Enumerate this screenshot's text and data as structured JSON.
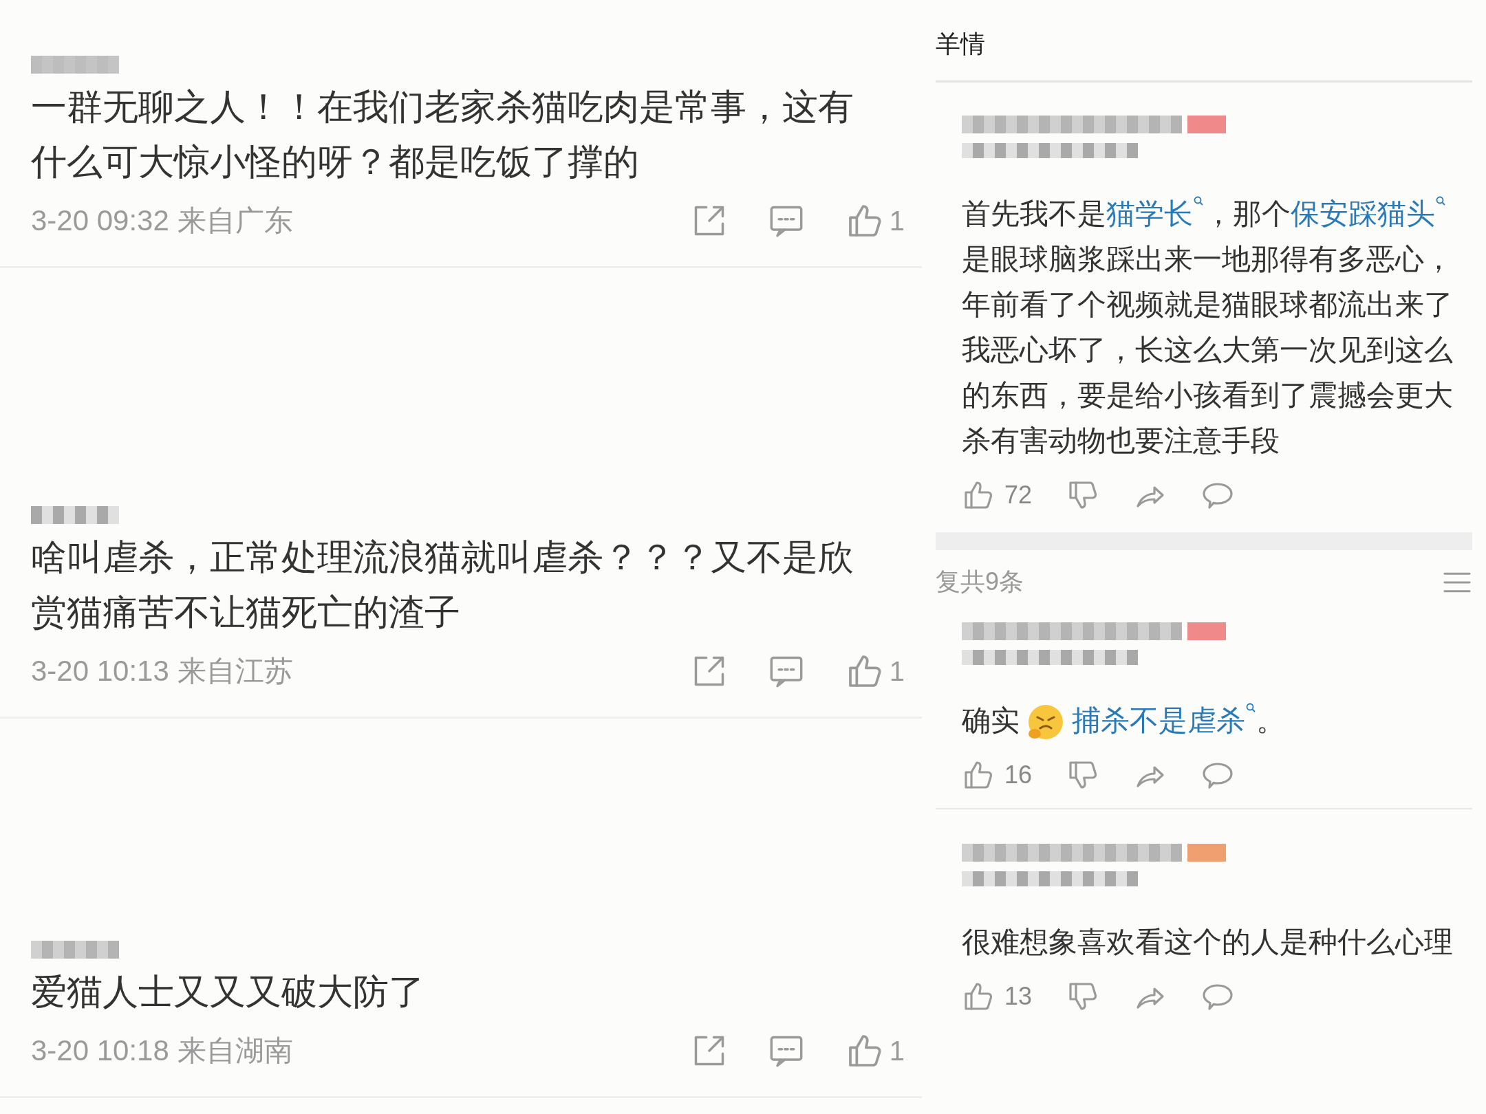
{
  "left_comments": [
    {
      "text": "一群无聊之人！！在我们老家杀猫吃肉是常事，这有什么可大惊小怪的呀？都是吃饭了撑的",
      "time": "3-20 09:32 来自广东",
      "likes": "1"
    },
    {
      "text": "啥叫虐杀，正常处理流浪猫就叫虐杀？？？又不是欣赏猫痛苦不让猫死亡的渣子",
      "time": "3-20 10:13 来自江苏",
      "likes": "1"
    },
    {
      "text": "爱猫人士又又又破大防了",
      "time": "3-20 10:18 来自湖南",
      "likes": "1"
    }
  ],
  "detail": {
    "title": "羊情",
    "main_comment": {
      "lines": [
        [
          {
            "kind": "text",
            "text": "首先我不是"
          },
          {
            "kind": "link",
            "text": "猫学长"
          },
          {
            "kind": "text",
            "text": "，那个"
          },
          {
            "kind": "link",
            "text": "保安踩猫头"
          }
        ],
        [
          {
            "kind": "text",
            "text": "是眼球脑浆踩出来一地那得有多恶心，"
          }
        ],
        [
          {
            "kind": "text",
            "text": "年前看了个视频就是猫眼球都流出来了"
          }
        ],
        [
          {
            "kind": "text",
            "text": "我恶心坏了，长这么大第一次见到这么"
          }
        ],
        [
          {
            "kind": "text",
            "text": "的东西，要是给小孩看到了震撼会更大"
          }
        ],
        [
          {
            "kind": "text",
            "text": "杀有害动物也要注意手段"
          }
        ]
      ],
      "likes": "72"
    },
    "reply_count": "复共9条",
    "replies": [
      {
        "lines": [
          [
            {
              "kind": "text",
              "text": "确实"
            },
            {
              "kind": "emoji"
            },
            {
              "kind": "link",
              "text": "捕杀不是虐杀"
            },
            {
              "kind": "text",
              "text": "。"
            }
          ]
        ],
        "likes": "16"
      },
      {
        "lines": [
          [
            {
              "kind": "text",
              "text": "很难想象喜欢看这个的人是种什么心理"
            }
          ]
        ],
        "likes": "13"
      }
    ]
  }
}
